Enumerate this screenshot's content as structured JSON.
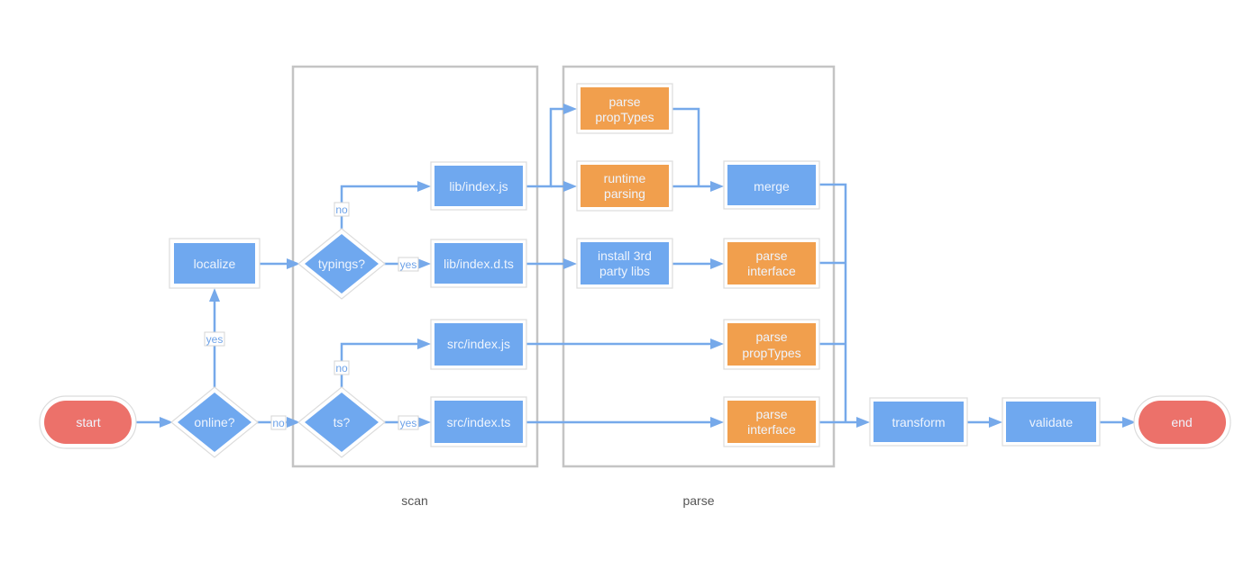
{
  "colors": {
    "process": "#6fa8ef",
    "parser": "#f19f4d",
    "terminal": "#ec716a",
    "edge": "#76a9ea",
    "cluster_border": "#c4c4c4"
  },
  "clusters": {
    "scan": {
      "label": "scan"
    },
    "parse": {
      "label": "parse"
    }
  },
  "nodes": {
    "start": {
      "label": "start",
      "shape": "terminal"
    },
    "online": {
      "label": "online?",
      "shape": "decision"
    },
    "localize": {
      "label": "localize",
      "shape": "process"
    },
    "typings": {
      "label": "typings?",
      "shape": "decision"
    },
    "ts": {
      "label": "ts?",
      "shape": "decision"
    },
    "lib_index_js": {
      "label": "lib/index.js",
      "shape": "process"
    },
    "lib_index_dts": {
      "label": "lib/index.d.ts",
      "shape": "process"
    },
    "src_index_js": {
      "label": "src/index.js",
      "shape": "process"
    },
    "src_index_ts": {
      "label": "src/index.ts",
      "shape": "process"
    },
    "parse_proptypes_1": {
      "label_line1": "parse",
      "label_line2": "propTypes",
      "shape": "parser"
    },
    "runtime_parsing": {
      "label_line1": "runtime",
      "label_line2": "parsing",
      "shape": "parser"
    },
    "install_libs": {
      "label_line1": "install 3rd",
      "label_line2": "party libs",
      "shape": "process"
    },
    "merge": {
      "label": "merge",
      "shape": "process"
    },
    "parse_interface_1": {
      "label_line1": "parse",
      "label_line2": "interface",
      "shape": "parser"
    },
    "parse_proptypes_2": {
      "label_line1": "parse",
      "label_line2": "propTypes",
      "shape": "parser"
    },
    "parse_interface_2": {
      "label_line1": "parse",
      "label_line2": "interface",
      "shape": "parser"
    },
    "transform": {
      "label": "transform",
      "shape": "process"
    },
    "validate": {
      "label": "validate",
      "shape": "process"
    },
    "end": {
      "label": "end",
      "shape": "terminal"
    }
  },
  "edge_labels": {
    "online_yes": "yes",
    "online_no": "no",
    "typings_no": "no",
    "typings_yes": "yes",
    "ts_no": "no",
    "ts_yes": "yes"
  },
  "edges": [
    [
      "start",
      "online",
      ""
    ],
    [
      "online",
      "localize",
      "yes"
    ],
    [
      "online",
      "ts",
      "no"
    ],
    [
      "localize",
      "typings",
      ""
    ],
    [
      "typings",
      "lib/index.js",
      "no"
    ],
    [
      "typings",
      "lib/index.d.ts",
      "yes"
    ],
    [
      "ts",
      "src/index.js",
      "no"
    ],
    [
      "ts",
      "src/index.ts",
      "yes"
    ],
    [
      "lib/index.js",
      "parse propTypes",
      ""
    ],
    [
      "lib/index.js",
      "runtime parsing",
      ""
    ],
    [
      "parse propTypes",
      "merge",
      ""
    ],
    [
      "runtime parsing",
      "merge",
      ""
    ],
    [
      "lib/index.d.ts",
      "install 3rd party libs",
      ""
    ],
    [
      "install 3rd party libs",
      "parse interface",
      ""
    ],
    [
      "src/index.js",
      "parse propTypes",
      ""
    ],
    [
      "src/index.ts",
      "parse interface",
      ""
    ],
    [
      "merge",
      "transform",
      ""
    ],
    [
      "parse interface",
      "transform",
      ""
    ],
    [
      "parse propTypes",
      "transform",
      ""
    ],
    [
      "parse interface",
      "transform",
      ""
    ],
    [
      "transform",
      "validate",
      ""
    ],
    [
      "validate",
      "end",
      ""
    ]
  ]
}
